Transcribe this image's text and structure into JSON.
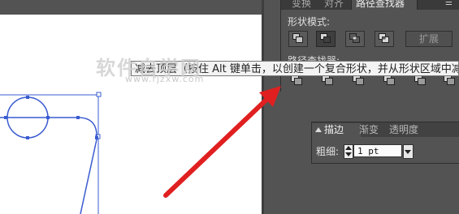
{
  "pathfinder_panel": {
    "tabs": [
      "变换",
      "对齐",
      "路径查找器"
    ],
    "active_tab": "路径查找器",
    "shape_modes_label": "形状模式:",
    "shape_mode_buttons": [
      {
        "name": "unite",
        "icon": "unite-icon"
      },
      {
        "name": "minus-front",
        "icon": "minus-front-icon",
        "pressed": true
      },
      {
        "name": "intersect",
        "icon": "intersect-icon"
      },
      {
        "name": "exclude",
        "icon": "exclude-icon"
      }
    ],
    "expand_label": "扩展",
    "pathfinders_label": "路径查找器:",
    "menu_icon": "panel-menu-icon"
  },
  "tooltip": {
    "text": "减去顶层（按住 Alt 键单击，以创建一个复合形状，并从形状区域中减去）"
  },
  "watermark": {
    "main": "软件自学网",
    "sub": "www.rjzxw.com"
  },
  "stroke_panel": {
    "tabs": [
      "描边",
      "渐变",
      "透明度"
    ],
    "active_tab": "描边",
    "weight_label": "粗细:",
    "weight_value": "1 pt"
  },
  "colors": {
    "ui_background": "#535353",
    "artboard": "#ffffff",
    "selection_path": "#3a5bd0",
    "arrow": "#e02020"
  }
}
